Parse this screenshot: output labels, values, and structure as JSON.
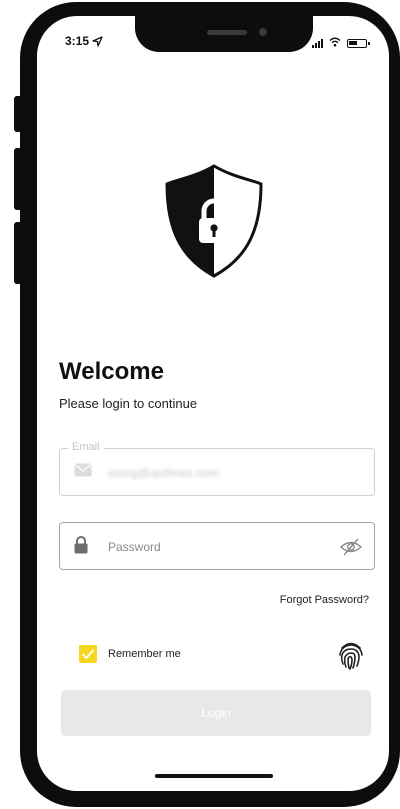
{
  "status_bar": {
    "time": "3:15"
  },
  "login": {
    "title": "Welcome",
    "subtitle": "Please login to continue",
    "email_label": "Email",
    "email_value": "soorg@authnex.com",
    "password_placeholder": "Password",
    "forgot_password": "Forgot Password?",
    "remember_me": "Remember me",
    "remember_checked": true,
    "login_button": "Login"
  },
  "colors": {
    "accent": "#f5d623",
    "button_disabled": "#e8e8e8",
    "text": "#111111"
  },
  "icons": [
    "location-arrow-icon",
    "signal-icon",
    "wifi-icon",
    "battery-icon",
    "shield-lock-icon",
    "envelope-icon",
    "lock-icon",
    "eye-off-icon",
    "checkmark-icon",
    "fingerprint-icon"
  ]
}
